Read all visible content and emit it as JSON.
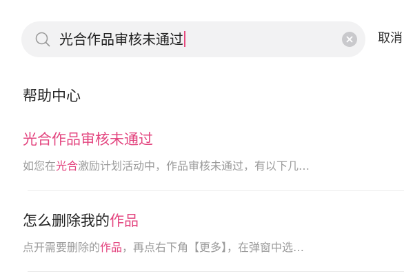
{
  "search": {
    "query": "光合作品审核未通过",
    "cancel_label": "取消",
    "icon": "search-icon",
    "clear_icon": "clear-icon"
  },
  "section": {
    "title": "帮助中心"
  },
  "results": [
    {
      "title": [
        {
          "text": "光合作品审核未通过",
          "hl": true
        }
      ],
      "desc": [
        {
          "text": "如您在",
          "hl": false
        },
        {
          "text": "光合",
          "hl": true
        },
        {
          "text": "激励计划活动中，作品审核未通过，有以下几…",
          "hl": false
        }
      ]
    },
    {
      "title": [
        {
          "text": "怎么删除我的",
          "hl": false
        },
        {
          "text": "作品",
          "hl": true
        }
      ],
      "desc": [
        {
          "text": "点开需要删除的",
          "hl": false
        },
        {
          "text": "作品",
          "hl": true
        },
        {
          "text": "，再点右下角【更多】，在弹窗中选…",
          "hl": false
        }
      ]
    }
  ],
  "colors": {
    "accent": "#e3457f",
    "caret": "#e64a7e",
    "secondary_text": "#9b9b9b",
    "search_bg": "#f2f2f3"
  }
}
